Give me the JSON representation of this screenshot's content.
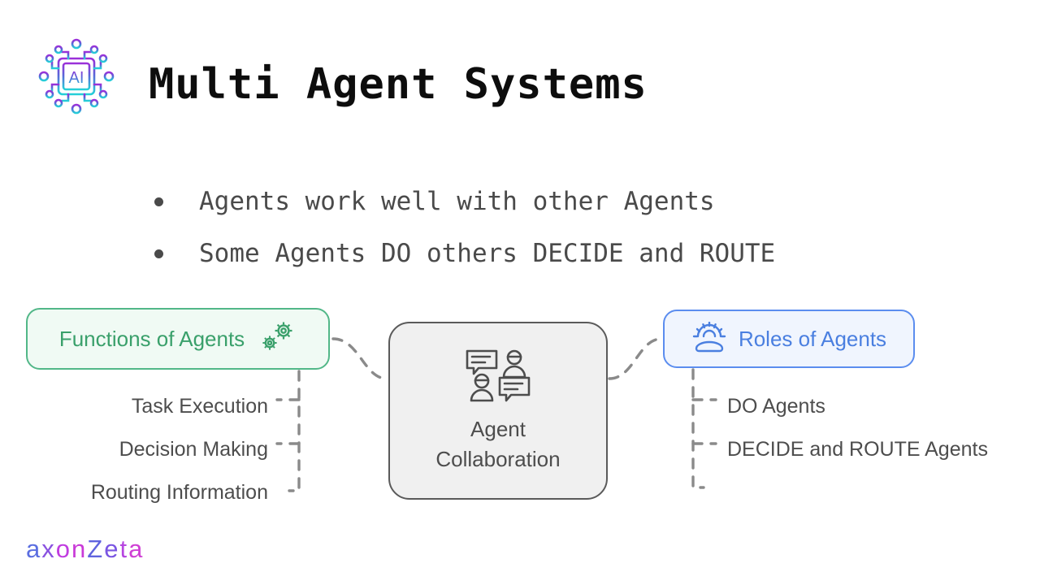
{
  "header": {
    "title": "Multi Agent Systems",
    "logo_icon": "ai-chip-icon",
    "logo_text": "AI",
    "logo_gradient_from": "#9b30d9",
    "logo_gradient_to": "#25d0d8"
  },
  "bullets": [
    {
      "text": "Agents work well with other Agents"
    },
    {
      "text": "Some Agents DO others DECIDE and ROUTE"
    }
  ],
  "diagram": {
    "left_node": {
      "label": "Functions of Agents",
      "icon": "gears-icon",
      "border_color": "#52b788",
      "fill_color": "#f0faf4",
      "text_color": "#3aa06b",
      "children": [
        "Task Execution",
        "Decision Making",
        "Routing Information"
      ]
    },
    "center_node": {
      "label_line1": "Agent",
      "label_line2": "Collaboration",
      "icon": "people-chat-collaboration-icon",
      "border_color": "#5a5a5a",
      "fill_color": "#f0f0f0",
      "text_color": "#4d4d4d"
    },
    "right_node": {
      "label": "Roles of Agents",
      "icon": "team-gear-icon",
      "border_color": "#5b8def",
      "fill_color": "#f0f5fe",
      "text_color": "#4a7fe0",
      "children": [
        "DO Agents",
        "DECIDE and ROUTE Agents"
      ]
    },
    "connector_color": "#8a8a8a",
    "connector_style": "dashed"
  },
  "footer": {
    "wordmark_letters": [
      {
        "char": "a",
        "color": "#5b6ee0"
      },
      {
        "char": "x",
        "color": "#8a52e0"
      },
      {
        "char": "o",
        "color": "#c03ce0"
      },
      {
        "char": "n",
        "color": "#c93ad8"
      },
      {
        "char": "Z",
        "color": "#5f63de"
      },
      {
        "char": "e",
        "color": "#7a55e2"
      },
      {
        "char": "t",
        "color": "#b646e0"
      },
      {
        "char": "a",
        "color": "#cf3fd4"
      }
    ],
    "wordmark_text": "axonZeta"
  }
}
